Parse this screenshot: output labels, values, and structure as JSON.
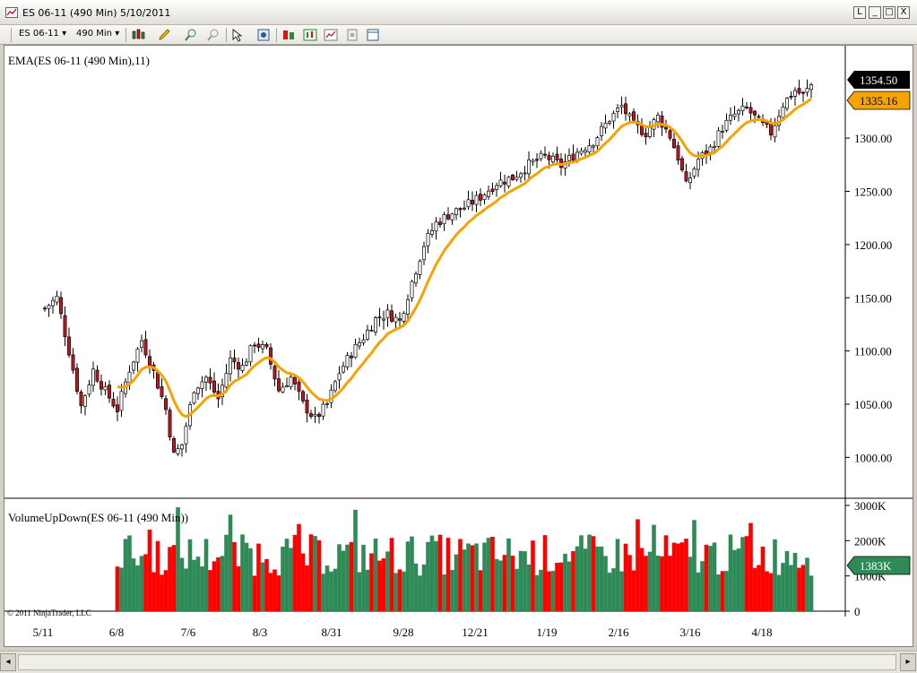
{
  "window": {
    "title": "ES 06-11 (490 Min)  5/10/2011",
    "controls": [
      "L",
      "_",
      "□",
      "X"
    ]
  },
  "toolbar": {
    "instrument": "ES 06-11",
    "interval": "490 Min"
  },
  "chart_data": [
    {
      "type": "candlestick",
      "title": "EMA(ES 06-11 (490 Min),11)",
      "ylim": [
        970,
        1370
      ],
      "y_ticks": [
        "1000.00",
        "1050.00",
        "1100.00",
        "1150.00",
        "1200.00",
        "1250.00",
        "1300.00"
      ],
      "last_price": "1354.50",
      "ema_value": "1335.16",
      "colors": {
        "up": "#ffffff",
        "down": "#c8141e",
        "ema": "#f5a300",
        "last_price_bg": "#000000",
        "ema_bg": "#f5a300"
      },
      "close_path": [
        {
          "t": 0,
          "v": 1140
        },
        {
          "t": 3,
          "v": 1150
        },
        {
          "t": 6,
          "v": 1100
        },
        {
          "t": 9,
          "v": 1048
        },
        {
          "t": 12,
          "v": 1082
        },
        {
          "t": 15,
          "v": 1062
        },
        {
          "t": 18,
          "v": 1045
        },
        {
          "t": 21,
          "v": 1083
        },
        {
          "t": 24,
          "v": 1110
        },
        {
          "t": 27,
          "v": 1080
        },
        {
          "t": 30,
          "v": 1045
        },
        {
          "t": 32,
          "v": 1002
        },
        {
          "t": 34,
          "v": 1012
        },
        {
          "t": 37,
          "v": 1065
        },
        {
          "t": 40,
          "v": 1075
        },
        {
          "t": 43,
          "v": 1055
        },
        {
          "t": 46,
          "v": 1092
        },
        {
          "t": 49,
          "v": 1085
        },
        {
          "t": 52,
          "v": 1108
        },
        {
          "t": 55,
          "v": 1100
        },
        {
          "t": 58,
          "v": 1063
        },
        {
          "t": 61,
          "v": 1075
        },
        {
          "t": 64,
          "v": 1050
        },
        {
          "t": 67,
          "v": 1036
        },
        {
          "t": 70,
          "v": 1050
        },
        {
          "t": 73,
          "v": 1080
        },
        {
          "t": 76,
          "v": 1098
        },
        {
          "t": 79,
          "v": 1113
        },
        {
          "t": 82,
          "v": 1130
        },
        {
          "t": 85,
          "v": 1135
        },
        {
          "t": 88,
          "v": 1128
        },
        {
          "t": 91,
          "v": 1165
        },
        {
          "t": 94,
          "v": 1200
        },
        {
          "t": 97,
          "v": 1220
        },
        {
          "t": 100,
          "v": 1228
        },
        {
          "t": 104,
          "v": 1235
        },
        {
          "t": 108,
          "v": 1245
        },
        {
          "t": 112,
          "v": 1258
        },
        {
          "t": 116,
          "v": 1263
        },
        {
          "t": 120,
          "v": 1275
        },
        {
          "t": 124,
          "v": 1283
        },
        {
          "t": 128,
          "v": 1274
        },
        {
          "t": 132,
          "v": 1287
        },
        {
          "t": 136,
          "v": 1297
        },
        {
          "t": 140,
          "v": 1318
        },
        {
          "t": 143,
          "v": 1330
        },
        {
          "t": 146,
          "v": 1312
        },
        {
          "t": 149,
          "v": 1305
        },
        {
          "t": 152,
          "v": 1320
        },
        {
          "t": 155,
          "v": 1302
        },
        {
          "t": 157,
          "v": 1282
        },
        {
          "t": 159,
          "v": 1255
        },
        {
          "t": 162,
          "v": 1280
        },
        {
          "t": 165,
          "v": 1290
        },
        {
          "t": 168,
          "v": 1310
        },
        {
          "t": 171,
          "v": 1322
        },
        {
          "t": 174,
          "v": 1328
        },
        {
          "t": 177,
          "v": 1315
        },
        {
          "t": 180,
          "v": 1305
        },
        {
          "t": 183,
          "v": 1332
        },
        {
          "t": 186,
          "v": 1345
        },
        {
          "t": 188,
          "v": 1340
        },
        {
          "t": 190,
          "v": 1350
        }
      ]
    },
    {
      "type": "bar",
      "title": "VolumeUpDown(ES 06-11 (490 Min))",
      "ylim": [
        0,
        3000
      ],
      "y_ticks": [
        "0",
        "1000K",
        "2000K",
        "3000K"
      ],
      "last_value": "1383K",
      "colors": {
        "up": "#2e8b57",
        "down": "#ff0000",
        "last_value_bg": "#2e8b57"
      },
      "volume_range": [
        400,
        3000
      ]
    }
  ],
  "x_axis": {
    "tick_labels": [
      "5/11",
      "6/8",
      "7/6",
      "8/3",
      "8/31",
      "9/28",
      "12/21",
      "1/19",
      "2/16",
      "3/16",
      "4/18"
    ]
  },
  "copyright": "© 2011 NinjaTrader, LLC"
}
